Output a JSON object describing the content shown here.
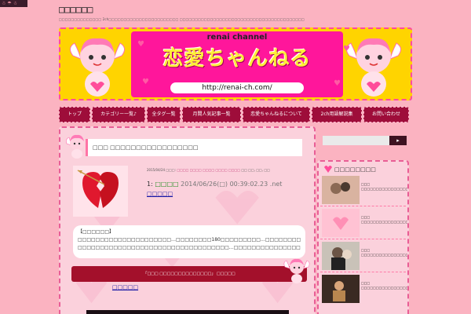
{
  "corner_badge": "☃ ☂ ☃",
  "site": {
    "title": "□□□□□□",
    "description": "□□□□□□□□□□□□□□ 2ch□□□□□□□□□□□□□□□□□□□□□□□ □□□□□□□□□□□□□□□□□□□□□□□□□□□□□□□□□□□□□□□□□"
  },
  "banner": {
    "small": "renai channel",
    "big": "恋愛ちゃんねる",
    "url": "http://renai-ch.com/"
  },
  "nav": [
    {
      "label": "トップ"
    },
    {
      "label": "カテゴリー一覧♪"
    },
    {
      "label": "全タグ一覧"
    },
    {
      "label": "月間人気記事一覧"
    },
    {
      "label": "恋愛ちゃんねるについて"
    },
    {
      "label": "2ch用語解説集"
    },
    {
      "label": "お問い合わせ"
    }
  ],
  "post": {
    "title": "□□□ □□□□□□□□□□□□□□□□□",
    "date": "2015/04/24",
    "meta_label": "□□□:",
    "tags": [
      "□□□□",
      "□□□□",
      "□□□□",
      "□□□□",
      "□□□□"
    ],
    "meta_tail": "□□ □□, □□, □□",
    "res_num": "1:",
    "res_name": "□□□□",
    "res_date": "2014/06/26(□) 00:39:02.23 .net",
    "body_link": "□□□□□",
    "summary_head": "【□□□□□□】",
    "summary_line1": "□□□□□□□□□□□□□□□□□□□□□…□□□□□□□□180□□□□□□□□□…□□□□□□□□□□□□□□□",
    "summary_line2": "□□□□□□□□□□□□□□□□□□□□□□□□□□□□□□□□□□…□□□□□□□□□□□□□□□□□□□□□□□",
    "read_button": "「□□□ □□□□□□□□□□□□□□」 □□□□□",
    "foot_link": "□□□□□"
  },
  "search": {
    "placeholder": "",
    "button": "▸"
  },
  "sidebar": {
    "heading": "□□□□□□□□",
    "items": [
      {
        "text": "□□□ □□□□□□□□□□□□□□□□□□□□□□□"
      },
      {
        "text": "□□□ □□□□□□□□□□□□□□□□□□□□"
      },
      {
        "text": "□□□ □□□□□□□□□□□□□□□□□□□□□□"
      },
      {
        "text": "□□□ □□□□□□□□□□□□□□□□□"
      }
    ]
  },
  "colors": {
    "page_bg": "#fbb3c1",
    "nav_bg": "#9e0d3a",
    "accent_pink": "#ff169b",
    "banner_yellow": "#ffd400",
    "read_button": "#a3102b"
  }
}
